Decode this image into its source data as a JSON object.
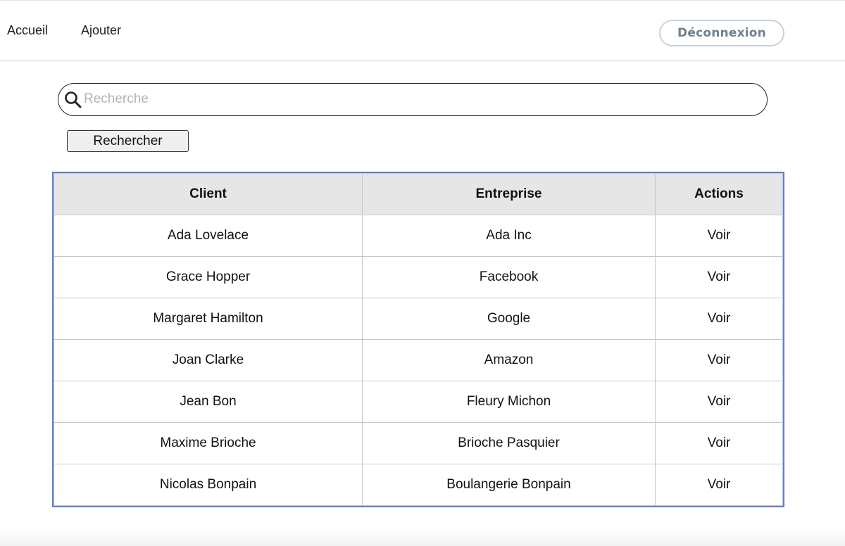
{
  "nav": {
    "home": "Accueil",
    "add": "Ajouter",
    "logout": "Déconnexion"
  },
  "search": {
    "placeholder": "Recherche",
    "value": "",
    "button_label": "Rechercher"
  },
  "table": {
    "headers": [
      "Client",
      "Entreprise",
      "Actions"
    ],
    "rows": [
      {
        "client": "Ada Lovelace",
        "company": "Ada Inc",
        "action": "Voir"
      },
      {
        "client": "Grace Hopper",
        "company": "Facebook",
        "action": "Voir"
      },
      {
        "client": "Margaret Hamilton",
        "company": "Google",
        "action": "Voir"
      },
      {
        "client": "Joan Clarke",
        "company": "Amazon",
        "action": "Voir"
      },
      {
        "client": "Jean Bon",
        "company": "Fleury Michon",
        "action": "Voir"
      },
      {
        "client": "Maxime Brioche",
        "company": "Brioche Pasquier",
        "action": "Voir"
      },
      {
        "client": "Nicolas Bonpain",
        "company": "Boulangerie Bonpain",
        "action": "Voir"
      }
    ]
  },
  "colors": {
    "table_border": "#5b7fd6",
    "header_bg": "#e6e6e6",
    "logout_text": "#6f7f93",
    "logout_border": "#c9d1dd"
  },
  "icons": {
    "search": "search-icon"
  }
}
